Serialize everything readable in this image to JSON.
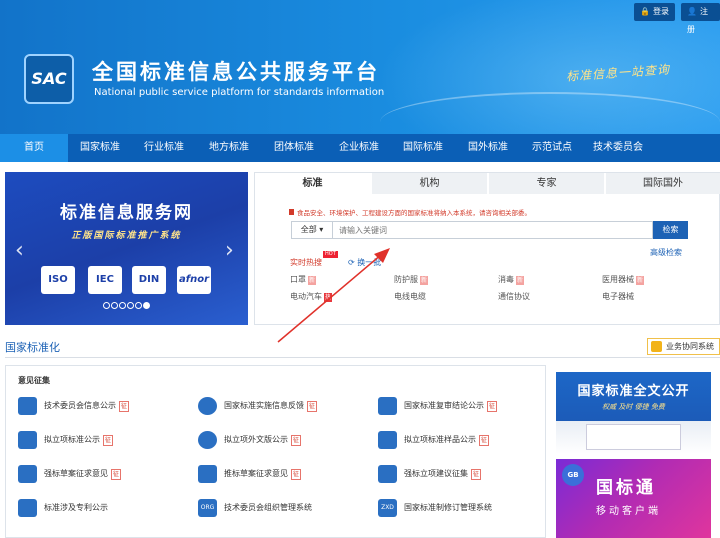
{
  "header": {
    "login_label": "登录",
    "register_label": "注册",
    "logo_text": "SAC",
    "title_cn": "全国标准信息公共服务平台",
    "title_en": "National public service platform  for standards information",
    "slogan": "标准信息一站查询"
  },
  "nav": {
    "items": [
      {
        "label": "首页"
      },
      {
        "label": "国家标准"
      },
      {
        "label": "行业标准"
      },
      {
        "label": "地方标准"
      },
      {
        "label": "团体标准"
      },
      {
        "label": "企业标准"
      },
      {
        "label": "国际标准"
      },
      {
        "label": "国外标准"
      },
      {
        "label": "示范试点"
      },
      {
        "label": "技术委员会"
      }
    ],
    "active_index": 0
  },
  "banner": {
    "title": "标准信息服务网",
    "subtitle": "正版国际标准推广系统",
    "logos": [
      "ISO",
      "IEC",
      "DIN",
      "afnor"
    ],
    "dots_count": 6,
    "active_dot": 5
  },
  "search": {
    "tabs": [
      "标准",
      "机构",
      "专家",
      "国际国外"
    ],
    "active_tab": 0,
    "notice": "食品安全、环境保护、工程建设方面的国家标准将纳入本系统，请咨询相关部委。",
    "scope_label": "全部",
    "placeholder": "请输入关键词",
    "button_label": "检索",
    "advanced_label": "高级检索",
    "hot_label": "实时热搜",
    "hot_badge": "HOT",
    "refresh_label": "换一批",
    "keywords": [
      {
        "text": "口罩",
        "badge": "新"
      },
      {
        "text": "防护服",
        "badge": "新"
      },
      {
        "text": "消毒",
        "badge": "新"
      },
      {
        "text": "医用器械",
        "badge": "新"
      },
      {
        "text": "电动汽车",
        "badge": "热"
      },
      {
        "text": "电线电缆",
        "badge": ""
      },
      {
        "text": "通信协议",
        "badge": ""
      },
      {
        "text": "电子器械",
        "badge": ""
      }
    ]
  },
  "section": {
    "title": "国家标准化",
    "business_button": "业务协同系统",
    "group_heading": "意见征集",
    "items": [
      {
        "label": "技术委员会信息公示",
        "tag": "征"
      },
      {
        "label": "国家标准实施信息反馈",
        "tag": "征"
      },
      {
        "label": "国家标准复审结论公示",
        "tag": "征"
      },
      {
        "label": "拟立项标准公示",
        "tag": "征"
      },
      {
        "label": "拟立项外文版公示",
        "tag": "征"
      },
      {
        "label": "拟立项标准样品公示",
        "tag": "征"
      },
      {
        "label": "强标草案征求意见",
        "tag": "征"
      },
      {
        "label": "推标草案征求意见",
        "tag": "征"
      },
      {
        "label": "强标立项建议征集",
        "tag": "征"
      },
      {
        "label": "标准涉及专利公示",
        "tag": ""
      },
      {
        "label": "技术委员会组织管理系统",
        "tag": ""
      },
      {
        "label": "国家标准制修订管理系统",
        "tag": ""
      }
    ],
    "icon_names": [
      "committee-icon",
      "feedback-icon",
      "review-icon",
      "bookmark-icon",
      "globe-icon",
      "bookmark-icon",
      "download-icon",
      "download-icon",
      "edit-icon",
      "document-icon",
      "org-icon",
      "zxd-icon"
    ],
    "icon_codes": [
      "",
      "",
      "",
      "",
      "",
      "",
      "",
      "",
      "",
      "",
      "ORG",
      "ZXD"
    ]
  },
  "ads": {
    "ad1_title": "国家标准全文公开",
    "ad1_sub": "权威  及时  便捷  免费",
    "ad2_badge": "GB",
    "ad2_title": "国标通",
    "ad2_sub": "移动客户端"
  },
  "colors": {
    "brand_blue": "#0b5fb6",
    "nav_active": "#1c8fe6",
    "accent_red": "#d23a2a",
    "annotation_red": "#e0312a"
  }
}
